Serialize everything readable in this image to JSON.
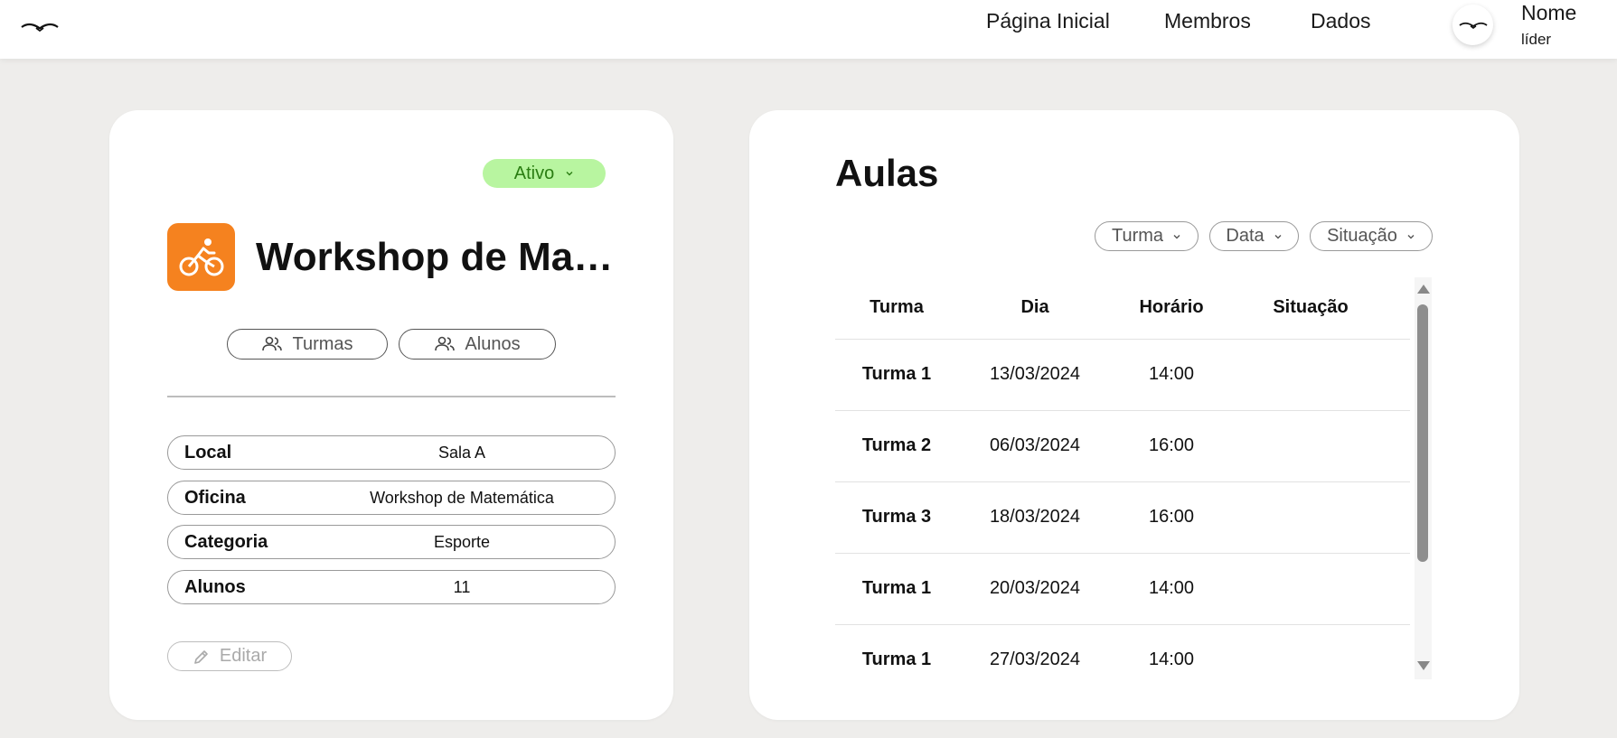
{
  "header": {
    "nav": [
      "Página Inicial",
      "Membros",
      "Dados"
    ],
    "user": {
      "name": "Nome",
      "role": "líder"
    }
  },
  "workshop": {
    "status": "Ativo",
    "title": "Workshop de Mat...",
    "icon": "bicycle-icon",
    "icon_bg": "#f5821f",
    "tabs": {
      "turmas": "Turmas",
      "alunos": "Alunos"
    },
    "info": [
      {
        "label": "Local",
        "value": "Sala A"
      },
      {
        "label": "Oficina",
        "value": "Workshop de Matemática"
      },
      {
        "label": "Categoria",
        "value": "Esporte"
      },
      {
        "label": "Alunos",
        "value": "11"
      }
    ],
    "edit_label": "Editar"
  },
  "aulas": {
    "title": "Aulas",
    "filters": [
      "Turma",
      "Data",
      "Situação"
    ],
    "columns": [
      "Turma",
      "Dia",
      "Horário",
      "Situação"
    ],
    "rows": [
      {
        "turma": "Turma 1",
        "dia": "13/03/2024",
        "horario": "14:00",
        "situacao": ""
      },
      {
        "turma": "Turma 2",
        "dia": "06/03/2024",
        "horario": "16:00",
        "situacao": ""
      },
      {
        "turma": "Turma 3",
        "dia": "18/03/2024",
        "horario": "16:00",
        "situacao": ""
      },
      {
        "turma": "Turma 1",
        "dia": "20/03/2024",
        "horario": "14:00",
        "situacao": ""
      },
      {
        "turma": "Turma 1",
        "dia": "27/03/2024",
        "horario": "14:00",
        "situacao": ""
      }
    ]
  },
  "colors": {
    "status_bg": "#b8f5a0",
    "status_text": "#2a7d12",
    "page_bg": "#eeedeb"
  }
}
